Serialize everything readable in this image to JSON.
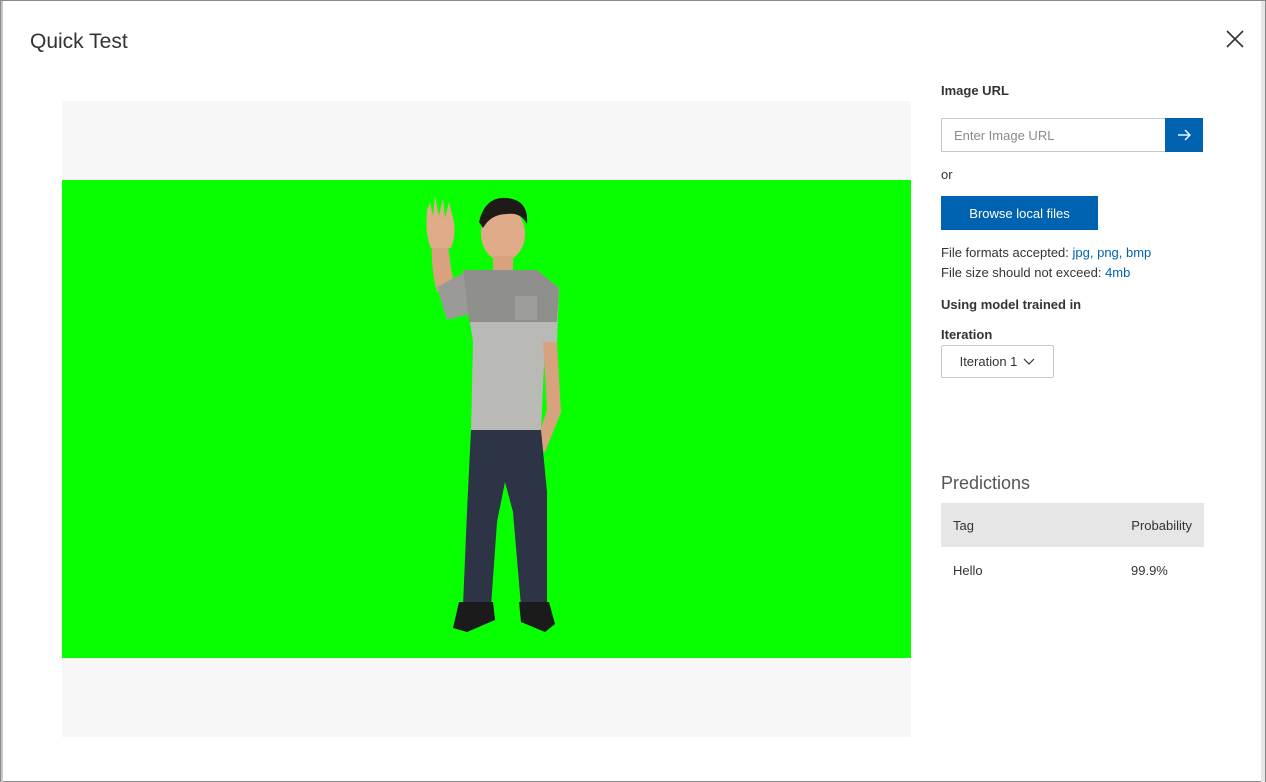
{
  "dialog": {
    "title": "Quick Test"
  },
  "image_url": {
    "label": "Image URL",
    "placeholder": "Enter Image URL"
  },
  "or_text": "or",
  "browse_label": "Browse local files",
  "file_info": {
    "formats_prefix": "File formats accepted:",
    "formats_value": "jpg, png, bmp",
    "size_prefix": "File size should not exceed:",
    "size_value": "4mb"
  },
  "model": {
    "label": "Using model trained in",
    "iteration_label": "Iteration",
    "iteration_value": "Iteration 1"
  },
  "predictions": {
    "title": "Predictions",
    "headers": {
      "tag": "Tag",
      "probability": "Probability"
    },
    "rows": [
      {
        "tag": "Hello",
        "probability": "99.9%"
      }
    ]
  },
  "colors": {
    "accent": "#0063b1",
    "image_background": "#08ff00"
  },
  "icons": [
    "close-icon",
    "arrow-right-icon",
    "chevron-down-icon"
  ]
}
